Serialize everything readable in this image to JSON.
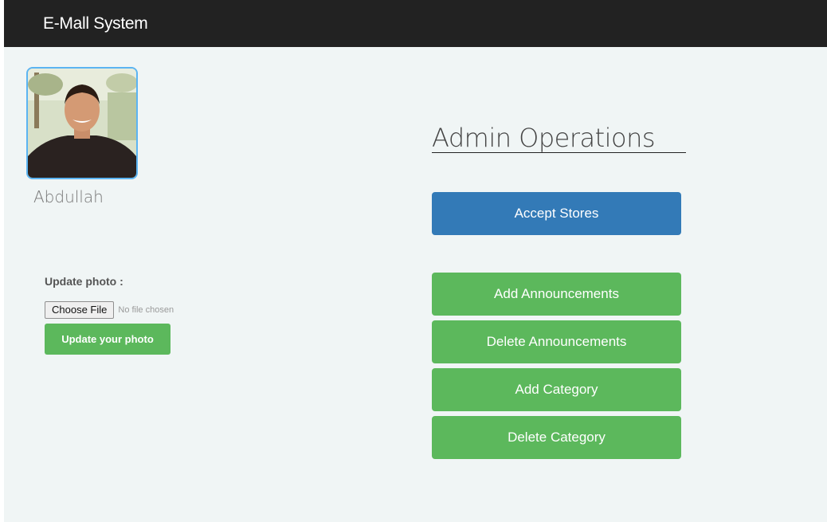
{
  "navbar": {
    "brand": "E-Mall System"
  },
  "profile": {
    "username": "Abdullah",
    "update_label": "Update photo :",
    "choose_file_label": "Choose File",
    "no_file_text": "No file chosen",
    "update_button": "Update your photo"
  },
  "admin": {
    "title": "Admin Operations",
    "accept_stores": "Accept Stores",
    "add_announcements": "Add Announcements",
    "delete_announcements": "Delete Announcements",
    "add_category": "Add Category",
    "delete_category": "Delete Category"
  },
  "colors": {
    "navbar": "#222222",
    "background": "#f0f5f5",
    "primary": "#337ab7",
    "success": "#5cb85c",
    "avatar_border": "#5bb4f2"
  }
}
